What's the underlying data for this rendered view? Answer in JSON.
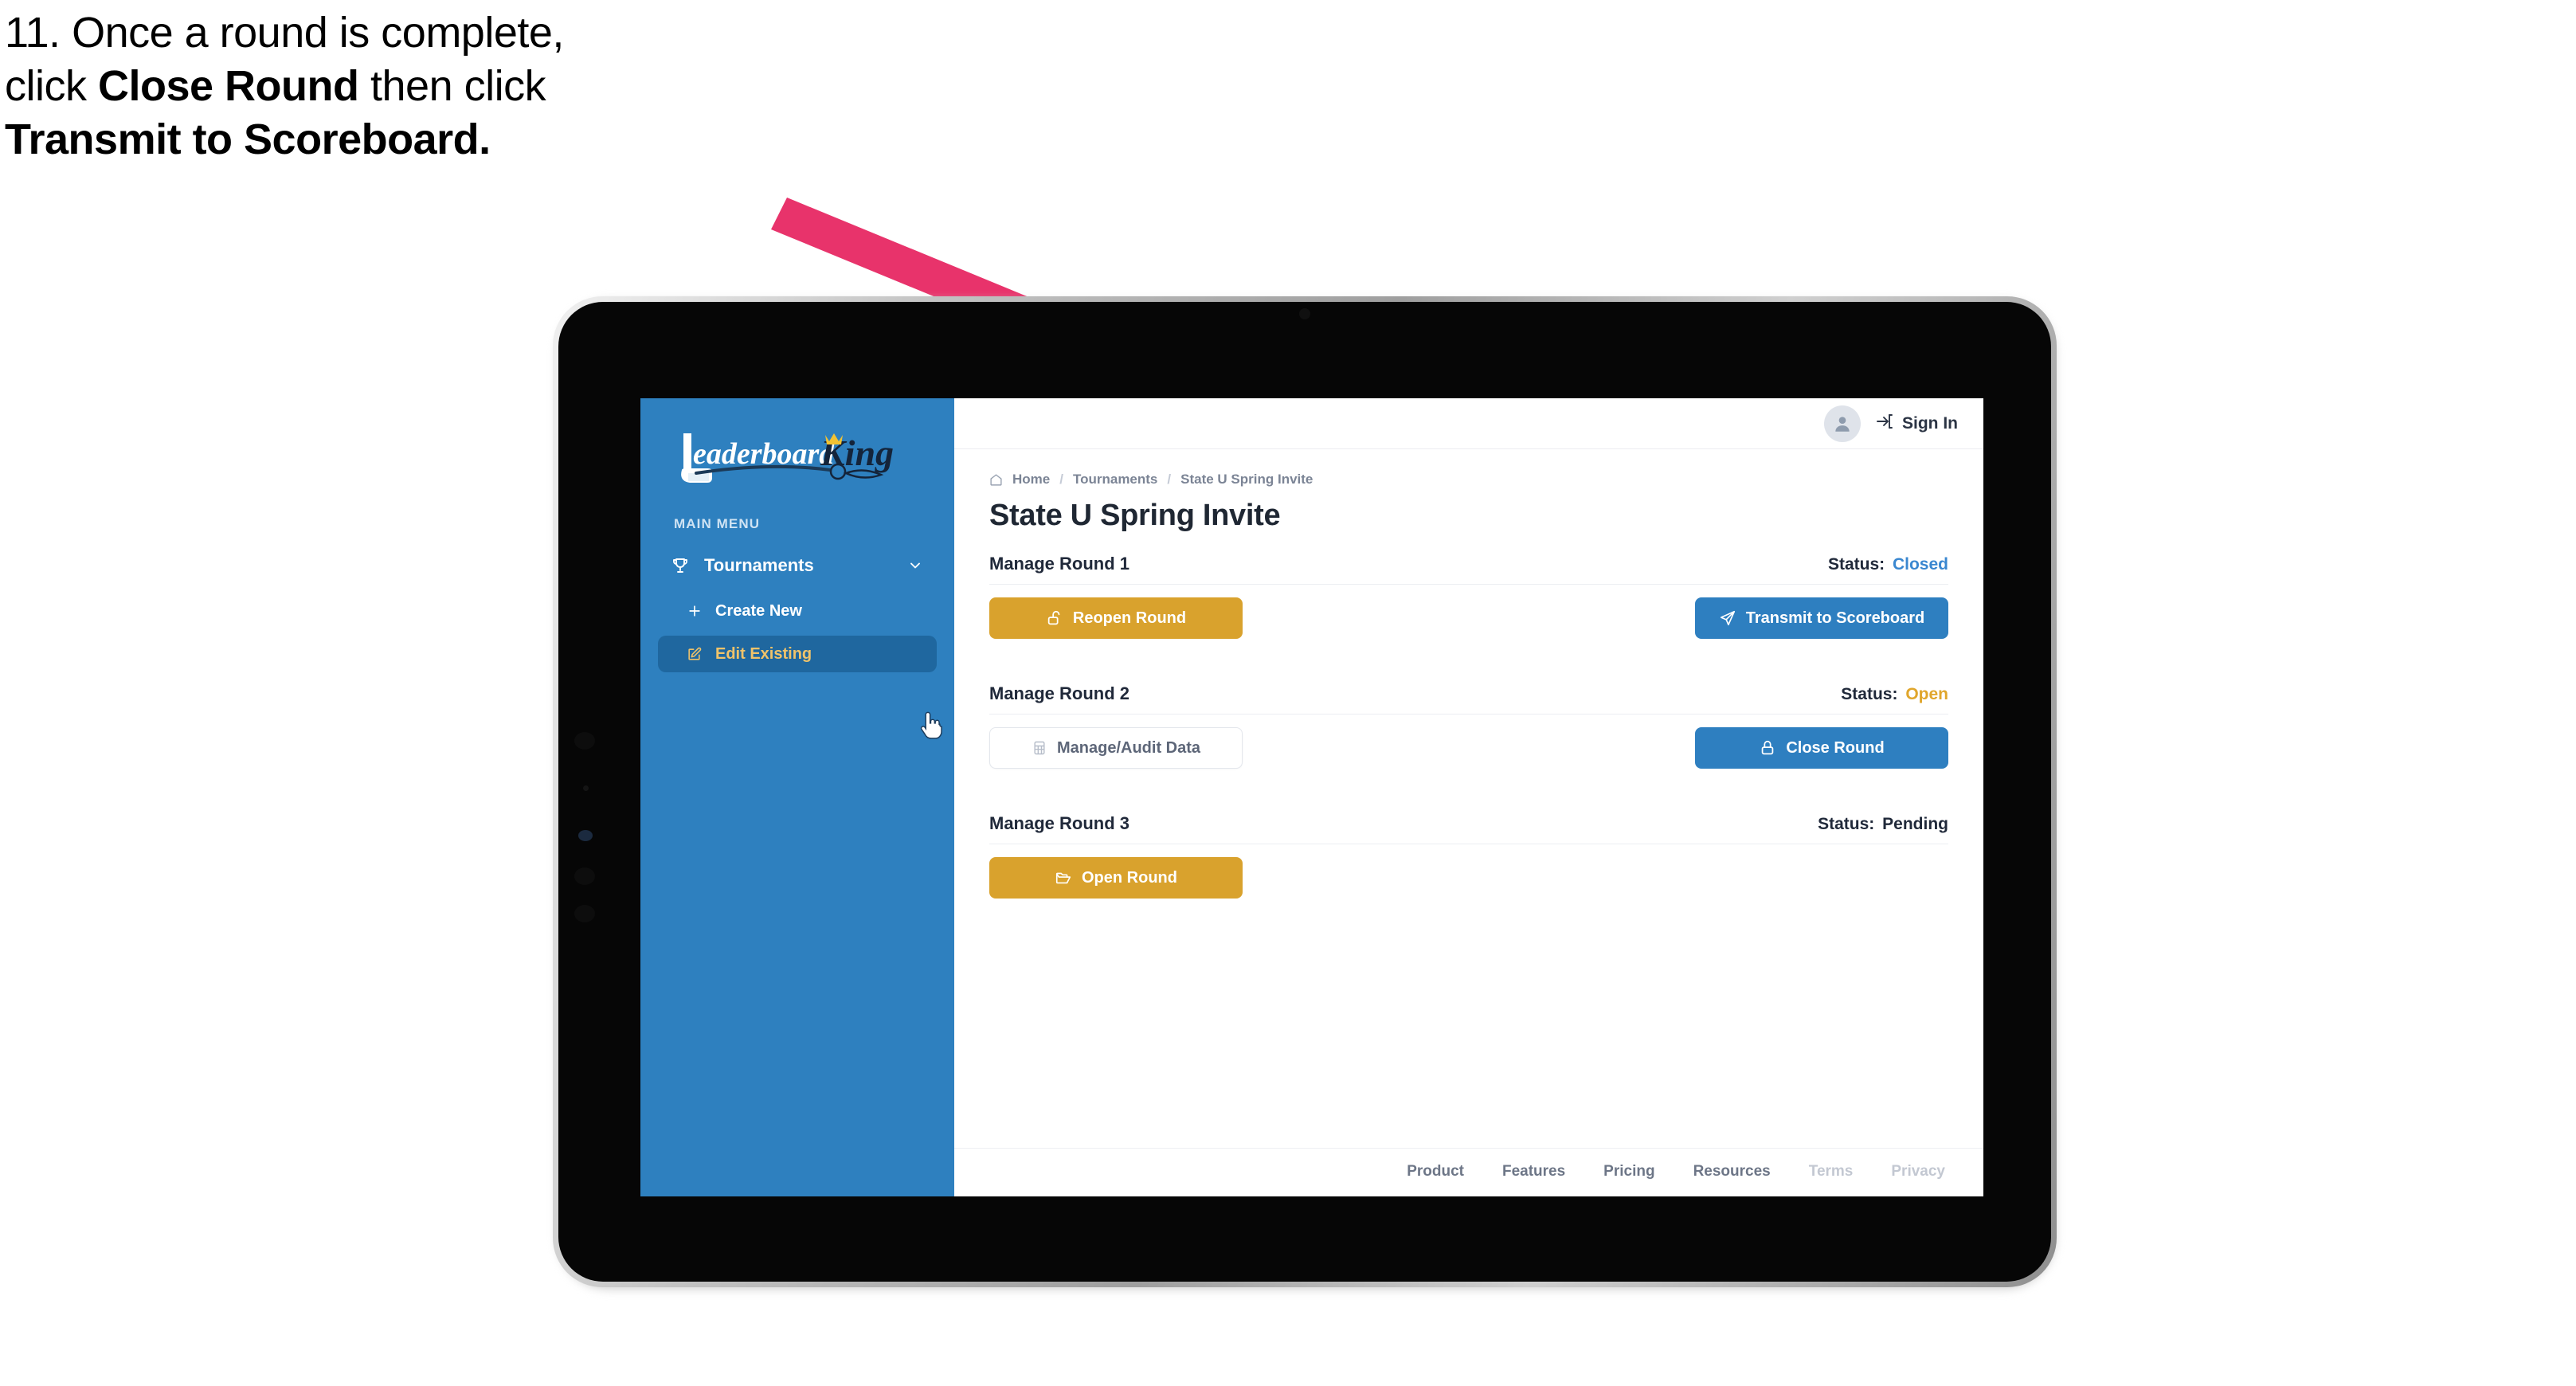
{
  "caption": {
    "line1": "11. Once a round is complete,",
    "line2_a": "click ",
    "line2_b": "Close Round",
    "line2_c": " then click",
    "line3": "Transmit to Scoreboard."
  },
  "colors": {
    "sidebar_blue": "#2e80bf",
    "sidebar_active": "#1f679f",
    "accent_gold": "#d9a22d",
    "accent_blue": "#2e7fc0",
    "arrow_pink": "#e8336b",
    "status_closed": "#3a87d0",
    "status_open": "#e0a62c",
    "status_pending": "#20293a"
  },
  "sidebar": {
    "logo": {
      "word1": "Leaderboard",
      "word2": "King"
    },
    "section_label": "MAIN MENU",
    "items": [
      {
        "label": "Tournaments",
        "icon": "trophy-icon",
        "chevron": "chevron-down-icon",
        "active": false
      },
      {
        "label": "Create New",
        "icon": "plus-icon",
        "active": false
      },
      {
        "label": "Edit Existing",
        "icon": "edit-pencil-icon",
        "active": true
      }
    ]
  },
  "topbar": {
    "avatar_icon": "user-avatar-icon",
    "signin_icon": "login-arrow-icon",
    "signin_label": "Sign In"
  },
  "breadcrumb": {
    "home_icon": "home-icon",
    "items": [
      "Home",
      "Tournaments",
      "State U Spring Invite"
    ],
    "separator": "/"
  },
  "page_title": "State U Spring Invite",
  "rounds": [
    {
      "title": "Manage Round 1",
      "status_label": "Status:",
      "status_value": "Closed",
      "status_kind": "closed",
      "left_button": {
        "label": "Reopen Round",
        "icon": "unlock-icon",
        "style": "gold"
      },
      "right_button": {
        "label": "Transmit to Scoreboard",
        "icon": "paper-plane-icon",
        "style": "blue"
      }
    },
    {
      "title": "Manage Round 2",
      "status_label": "Status:",
      "status_value": "Open",
      "status_kind": "open",
      "left_button": {
        "label": "Manage/Audit Data",
        "icon": "table-grid-icon",
        "style": "ghost"
      },
      "right_button": {
        "label": "Close Round",
        "icon": "lock-icon",
        "style": "blue"
      }
    },
    {
      "title": "Manage Round 3",
      "status_label": "Status:",
      "status_value": "Pending",
      "status_kind": "pending",
      "left_button": {
        "label": "Open Round",
        "icon": "open-folder-icon",
        "style": "gold"
      },
      "right_button": null
    }
  ],
  "footer": {
    "links": [
      {
        "label": "Product",
        "muted": false
      },
      {
        "label": "Features",
        "muted": false
      },
      {
        "label": "Pricing",
        "muted": false
      },
      {
        "label": "Resources",
        "muted": false
      },
      {
        "label": "Terms",
        "muted": true
      },
      {
        "label": "Privacy",
        "muted": true
      }
    ]
  }
}
